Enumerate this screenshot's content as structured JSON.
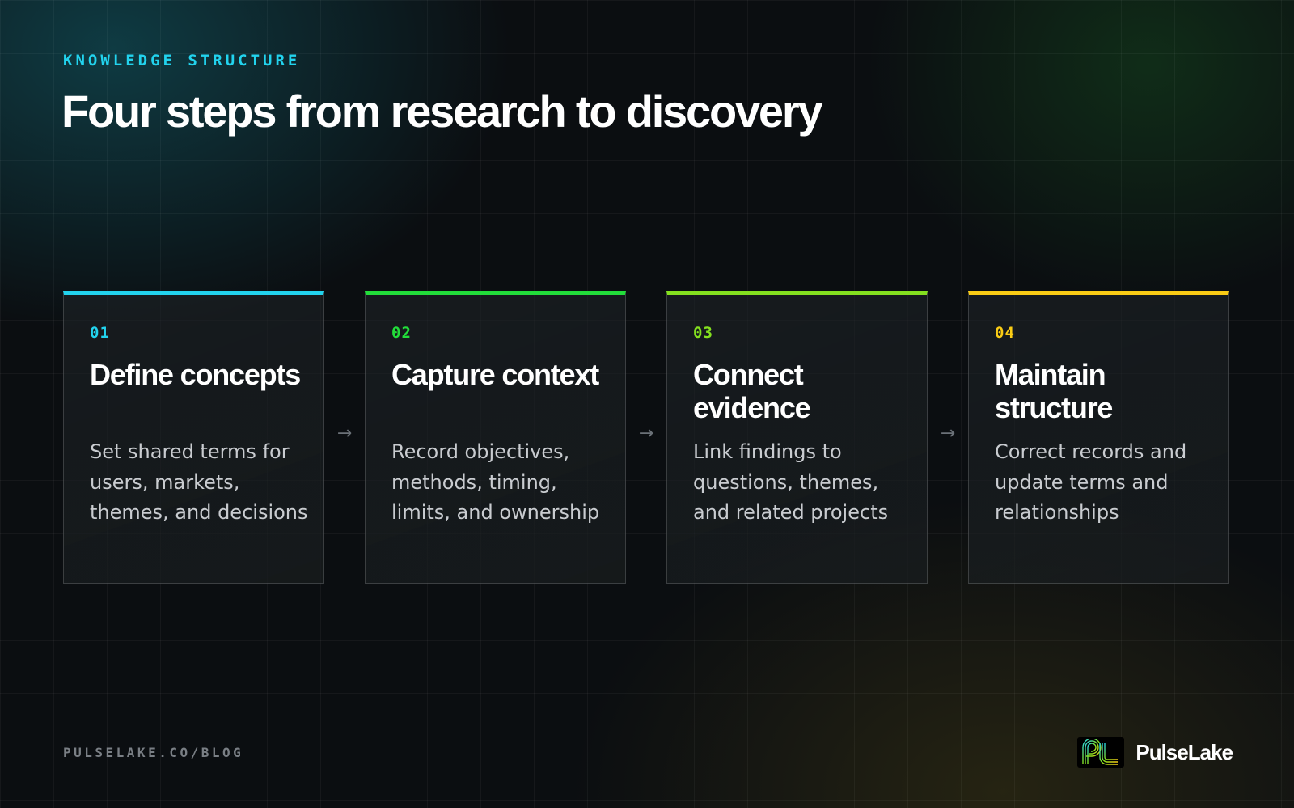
{
  "header": {
    "eyebrow": "KNOWLEDGE STRUCTURE",
    "title": "Four steps from research to discovery"
  },
  "steps": [
    {
      "number": "01",
      "title": "Define concepts",
      "description": "Set shared terms for users, markets, themes, and decisions",
      "accent_color": "#22d3ee"
    },
    {
      "number": "02",
      "title": "Capture context",
      "description": "Record objectives, methods, timing, limits, and ownership",
      "accent_color": "#22dd3a"
    },
    {
      "number": "03",
      "title": "Connect evidence",
      "description": "Link findings to questions, themes, and related projects",
      "accent_color": "#84e01f"
    },
    {
      "number": "04",
      "title": "Maintain structure",
      "description": "Correct records and update terms and relationships",
      "accent_color": "#facc15"
    }
  ],
  "arrows": [
    "→",
    "→",
    "→"
  ],
  "footer": {
    "url": "PULSELAKE.CO/BLOG",
    "brand_name": "PulseLake",
    "brand_icon": "pulselake-logo-icon"
  }
}
